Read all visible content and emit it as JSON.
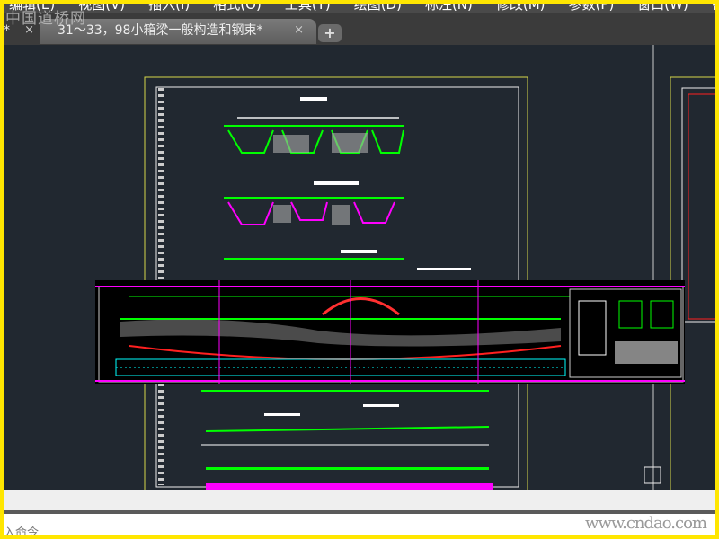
{
  "watermark": "中国道桥网",
  "menu": [
    "编辑(E)",
    "视图(V)",
    "插入(I)",
    "格式(O)",
    "工具(T)",
    "绘图(D)",
    "标注(N)",
    "修改(M)",
    "参数(P)",
    "窗口(W)",
    "帮"
  ],
  "tabs": [
    {
      "label": "*",
      "close": "×"
    },
    {
      "label": "31～33，98小箱梁一般构造和钢束*",
      "close": "×"
    }
  ],
  "add_tab": "+",
  "command": {
    "prompt": "入命令"
  },
  "site_watermark": "www.cndao.com",
  "colors": {
    "canvas": "#212830",
    "frame": "#ffe600",
    "green": "#00ff00",
    "magenta": "#ff00ff",
    "red": "#ff2020",
    "cyan": "#00ffff"
  }
}
